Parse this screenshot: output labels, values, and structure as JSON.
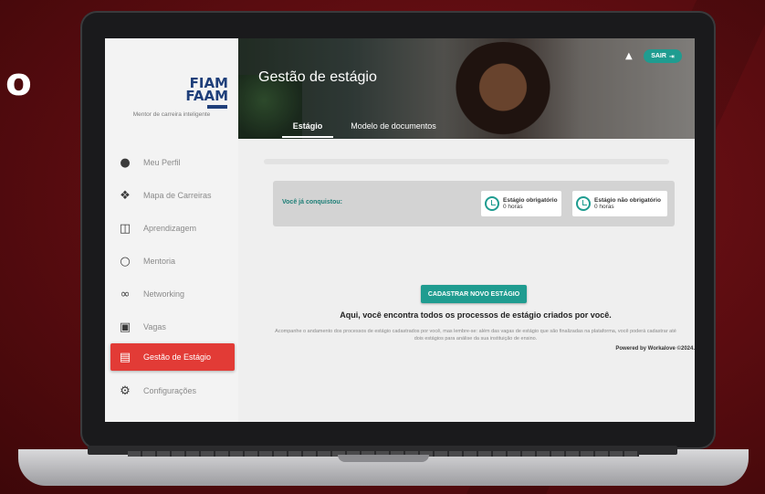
{
  "background": {
    "letter": "o",
    "color": "#6b0e13"
  },
  "sidebar": {
    "logo_line1": "FIAM",
    "logo_line2": "FAAM",
    "tagline": "Mentor de carreira inteligente",
    "items": [
      {
        "label": "Meu Perfil",
        "icon": "user-icon"
      },
      {
        "label": "Mapa de Carreiras",
        "icon": "map-icon"
      },
      {
        "label": "Aprendizagem",
        "icon": "book-icon"
      },
      {
        "label": "Mentoria",
        "icon": "chat-icon"
      },
      {
        "label": "Networking",
        "icon": "people-icon"
      },
      {
        "label": "Vagas",
        "icon": "briefcase-icon"
      },
      {
        "label": "Gestão de Estágio",
        "icon": "document-icon",
        "active": true
      },
      {
        "label": "Configurações",
        "icon": "gear-icon"
      }
    ],
    "active_color": "#e23b36"
  },
  "header": {
    "title": "Gestão de estágio",
    "logout_label": "SAIR",
    "tabs": [
      {
        "label": "Estágio",
        "active": true
      },
      {
        "label": "Modelo de documentos",
        "active": false
      }
    ]
  },
  "main": {
    "achievements_label": "Você já conquistou:",
    "badges": [
      {
        "title": "Estágio obrigatório",
        "value": "0 horas"
      },
      {
        "title": "Estágio não obrigatório",
        "value": "0 horas"
      }
    ],
    "cta_label": "CADASTRAR NOVO ESTÁGIO",
    "headline": "Aqui, você encontra todos os processos de estágio criados por você.",
    "description": "Acompanhe o andamento dos processos de estágio cadastrados por você, mas lembre-se: além das vagas de estágio que são finalizadas na plataforma, você poderá cadastrar até dois estágios para análise da sua instituição de ensino.",
    "powered_by": "Powered by Workalove ©2024.",
    "accent_color": "#1f9c90"
  }
}
